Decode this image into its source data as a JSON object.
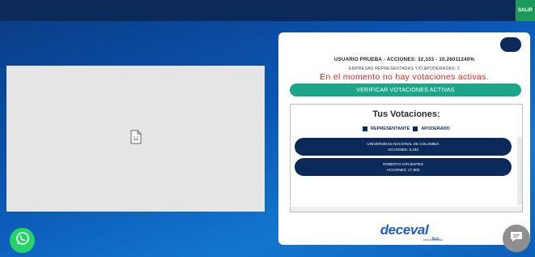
{
  "header": {
    "exit_label": "SALIR"
  },
  "panel": {
    "user_line": "USUARIO PRUEBA - ACCIONES: 32,333 - 10.26011240%",
    "companies_line": "EMPRESAS REPRESENTADAS Y/O APODERADAS: 2",
    "status_message": "En el momento no hay votaciones activas.",
    "verify_button": "VERIFICAR VOTACIONES ACTIVAS",
    "votes_title": "Tus Votaciones:",
    "legend": [
      {
        "label": "REPRESENTANTE",
        "color": "#0b2a5a"
      },
      {
        "label": "APODERADO",
        "color": "#0b2a5a"
      }
    ],
    "entities": [
      {
        "name": "UNIVERSIDAD NACIONAL DE COLOMBIA",
        "shares": "ACCIONES: 5,433"
      },
      {
        "name": "ROBERTO CIFUENTES",
        "shares": "ACCIONES: 27,900"
      }
    ],
    "logo_text": "deceval",
    "logo_sub": "una empresa",
    "logo_tmc": "bvc"
  },
  "colors": {
    "primary_navy": "#0b2a5a",
    "accent_green": "#1ba68a",
    "alert_red": "#e0251b"
  }
}
